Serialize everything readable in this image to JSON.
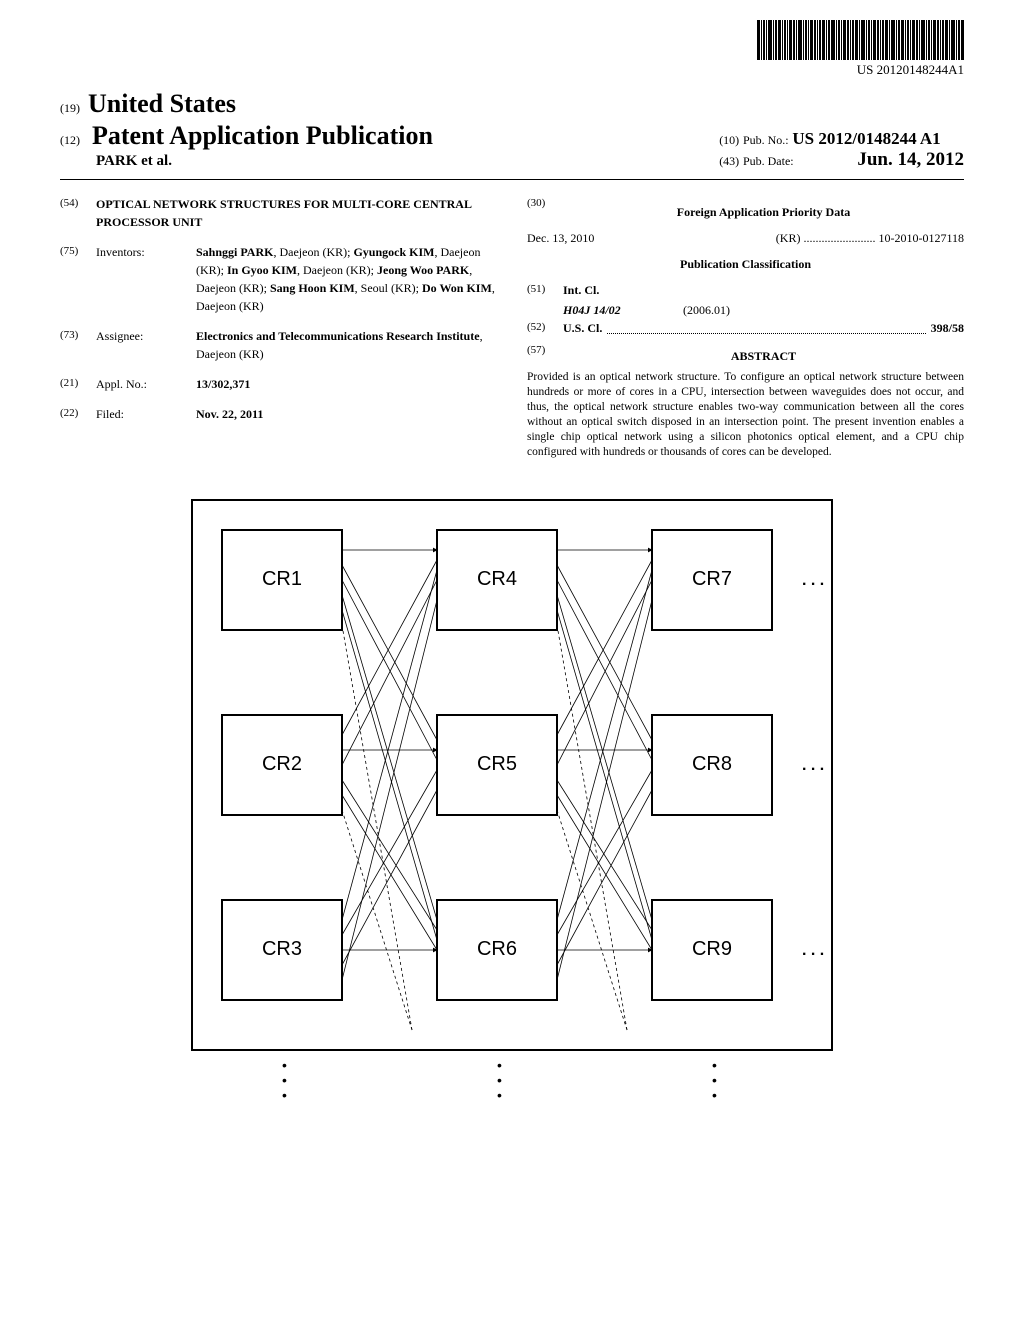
{
  "barcode_text": "US 20120148244A1",
  "header": {
    "prefix_19": "(19)",
    "country": "United States",
    "prefix_12": "(12)",
    "pub_title": "Patent Application Publication",
    "authors": "PARK et al.",
    "prefix_10": "(10)",
    "pub_no_label": "Pub. No.:",
    "pub_no_value": "US 2012/0148244 A1",
    "prefix_43": "(43)",
    "pub_date_label": "Pub. Date:",
    "pub_date_value": "Jun. 14, 2012"
  },
  "left": {
    "c54": "(54)",
    "title": "OPTICAL NETWORK STRUCTURES FOR MULTI-CORE CENTRAL PROCESSOR UNIT",
    "c75": "(75)",
    "inventors_label": "Inventors:",
    "inventors_html": "Sahnggi PARK, Daejeon (KR); Gyungock KIM, Daejeon (KR); In Gyoo KIM, Daejeon (KR); Jeong Woo PARK, Daejeon (KR); Sang Hoon KIM, Seoul (KR); Do Won KIM, Daejeon (KR)",
    "inventors": [
      {
        "name": "Sahnggi PARK",
        "loc": "Daejeon (KR)"
      },
      {
        "name": "Gyungock KIM",
        "loc": "Daejeon (KR)"
      },
      {
        "name": "In Gyoo KIM",
        "loc": "Daejeon (KR)"
      },
      {
        "name": "Jeong Woo PARK",
        "loc": "Daejeon (KR)"
      },
      {
        "name": "Sang Hoon KIM",
        "loc": "Seoul (KR)"
      },
      {
        "name": "Do Won KIM",
        "loc": "Daejeon (KR)"
      }
    ],
    "c73": "(73)",
    "assignee_label": "Assignee:",
    "assignee_name": "Electronics and Telecommunications Research Institute",
    "assignee_loc": "Daejeon (KR)",
    "c21": "(21)",
    "appl_label": "Appl. No.:",
    "appl_no": "13/302,371",
    "c22": "(22)",
    "filed_label": "Filed:",
    "filed_date": "Nov. 22, 2011"
  },
  "right": {
    "c30": "(30)",
    "foreign_title": "Foreign Application Priority Data",
    "priority_date": "Dec. 13, 2010",
    "priority_country": "(KR)",
    "priority_dots": "........................",
    "priority_no": "10-2010-0127118",
    "pub_class_title": "Publication Classification",
    "c51": "(51)",
    "int_cl_label": "Int. Cl.",
    "int_cl_code": "H04J 14/02",
    "int_cl_date": "(2006.01)",
    "c52": "(52)",
    "us_cl_label": "U.S. Cl.",
    "us_cl_value": "398/58",
    "c57": "(57)",
    "abstract_label": "ABSTRACT",
    "abstract_text": "Provided is an optical network structure. To configure an optical network structure between hundreds or more of cores in a CPU, intersection between waveguides does not occur, and thus, the optical network structure enables two-way communication between all the cores without an optical switch disposed in an intersection point. The present invention enables a single chip optical network using a silicon photonics optical element, and a CPU chip configured with hundreds or thousands of cores can be developed."
  },
  "figure": {
    "cores": [
      "CR1",
      "CR2",
      "CR3",
      "CR4",
      "CR5",
      "CR6",
      "CR7",
      "CR8",
      "CR9"
    ],
    "ellipsis": ". . .",
    "vdots": "•"
  }
}
